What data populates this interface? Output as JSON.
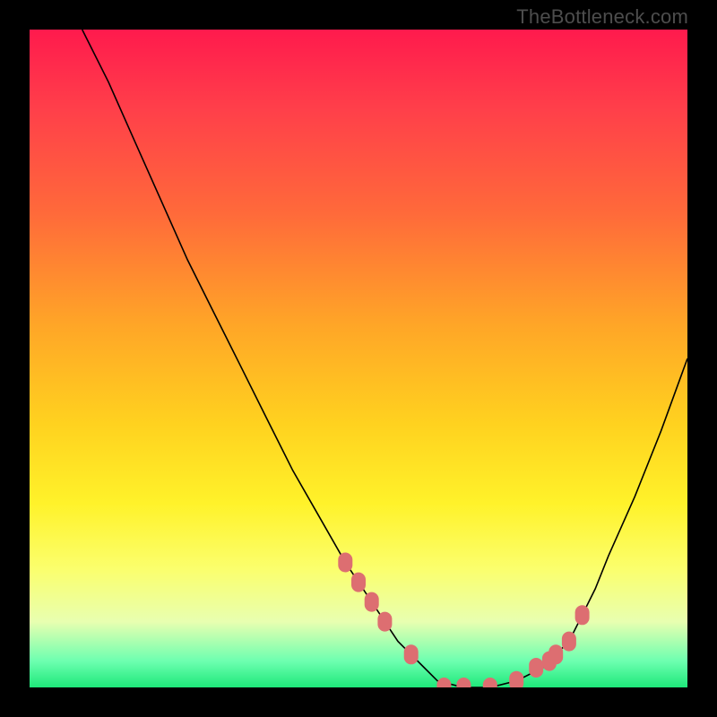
{
  "watermark": "TheBottleneck.com",
  "colors": {
    "page_bg": "#000000",
    "gradient_top": "#ff1a4d",
    "gradient_bottom": "#1ee87a",
    "curve": "#000000",
    "marker": "#dd6e71"
  },
  "chart_data": {
    "type": "line",
    "title": "",
    "xlabel": "",
    "ylabel": "",
    "xlim": [
      0,
      100
    ],
    "ylim": [
      0,
      100
    ],
    "series": [
      {
        "name": "bottleneck-curve",
        "x": [
          8,
          12,
          16,
          20,
          24,
          28,
          32,
          36,
          40,
          44,
          48,
          52,
          56,
          58,
          60,
          62,
          66,
          70,
          74,
          78,
          80,
          82,
          84,
          86,
          88,
          92,
          96,
          100
        ],
        "y": [
          100,
          92,
          83,
          74,
          65,
          57,
          49,
          41,
          33,
          26,
          19,
          13,
          7,
          5,
          3,
          1,
          0,
          0,
          1,
          3,
          5,
          7,
          11,
          15,
          20,
          29,
          39,
          50
        ]
      }
    ],
    "markers": {
      "name": "highlighted-points",
      "x": [
        48,
        50,
        52,
        54,
        58,
        63,
        66,
        70,
        74,
        77,
        79,
        80,
        82,
        84
      ],
      "y": [
        19,
        16,
        13,
        10,
        5,
        0,
        0,
        0,
        1,
        3,
        4,
        5,
        7,
        11
      ]
    }
  }
}
